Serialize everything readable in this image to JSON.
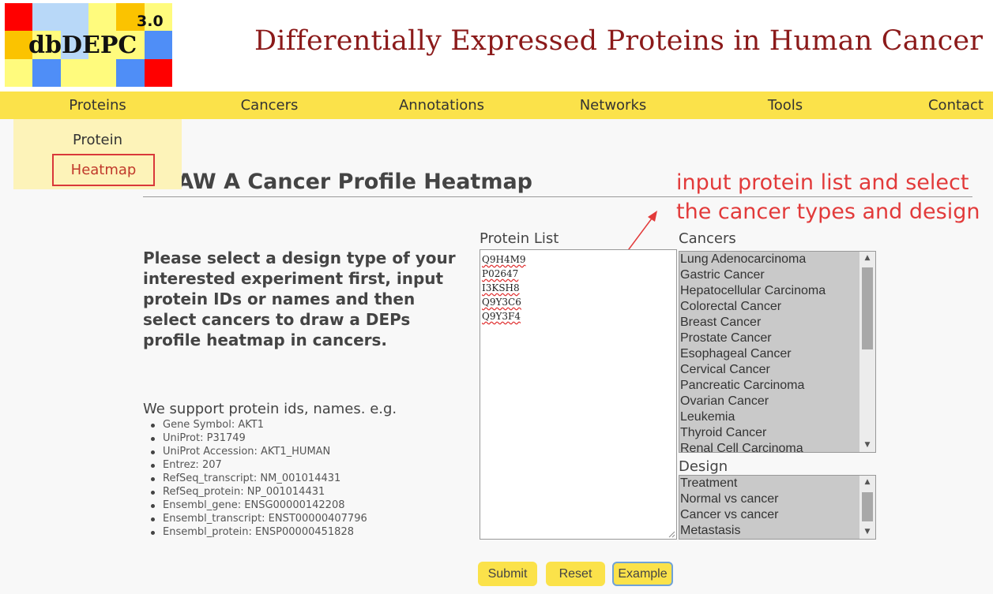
{
  "logo": {
    "text": "dbDEPC",
    "version": "3.0",
    "colors": [
      "#ff0000",
      "#b8d8f8",
      "#b8d8f8",
      "#fffb7d",
      "#fbc300",
      "#fffb7d",
      "#fbc300",
      "#fffb7d",
      "#b8d8f8",
      "#fffb7d",
      "#fffb7d",
      "#4f8ef7",
      "#fffb7d",
      "#4f8ef7",
      "#fffb7d",
      "#fffb7d",
      "#4f8ef7",
      "#ff0000"
    ]
  },
  "header": {
    "title": "Differentially Expressed Proteins in Human Cancer"
  },
  "nav": {
    "items": [
      "Proteins",
      "Cancers",
      "Annotations",
      "Networks",
      "Tools",
      "Contact"
    ]
  },
  "dropdown": {
    "items": [
      "Protein",
      "Heatmap"
    ]
  },
  "page": {
    "heading": "DRAW A Cancer Profile Heatmap"
  },
  "annotation": {
    "line1": "input protein list and select",
    "line2": "the cancer types and design",
    "color": "#e23a3a"
  },
  "intro": {
    "text": "Please select a design type of your interested experiment first, input protein IDs or names and then select cancers to draw a DEPs profile heatmap in cancers."
  },
  "support": {
    "title": "We support protein ids, names. e.g.",
    "items": [
      "Gene Symbol: AKT1",
      "UniProt: P31749",
      "UniProt Accession: AKT1_HUMAN",
      "Entrez: 207",
      "RefSeq_transcript: NM_001014431",
      "RefSeq_protein: NP_001014431",
      "Ensembl_gene: ENSG00000142208",
      "Ensembl_transcript: ENST00000407796",
      "Ensembl_protein: ENSP00000451828"
    ]
  },
  "protein_list": {
    "label": "Protein List",
    "lines": [
      "Q9H4M9",
      "P02647",
      "I3KSH8",
      "Q9Y3C6",
      "Q9Y3F4"
    ]
  },
  "cancers": {
    "label": "Cancers",
    "options": [
      "Lung Adenocarcinoma",
      "Gastric Cancer",
      "Hepatocellular Carcinoma",
      "Colorectal Cancer",
      "Breast Cancer",
      "Prostate Cancer",
      "Esophageal Cancer",
      "Cervical Cancer",
      "Pancreatic Carcinoma",
      "Ovarian Cancer",
      "Leukemia",
      "Thyroid Cancer",
      "Renal Cell Carcinoma"
    ],
    "scroll_position": 0
  },
  "design": {
    "label": "Design",
    "options": [
      "Treatment",
      "Normal vs cancer",
      "Cancer vs cancer",
      "Metastasis"
    ]
  },
  "buttons": {
    "submit": "Submit",
    "reset": "Reset",
    "example": "Example"
  }
}
